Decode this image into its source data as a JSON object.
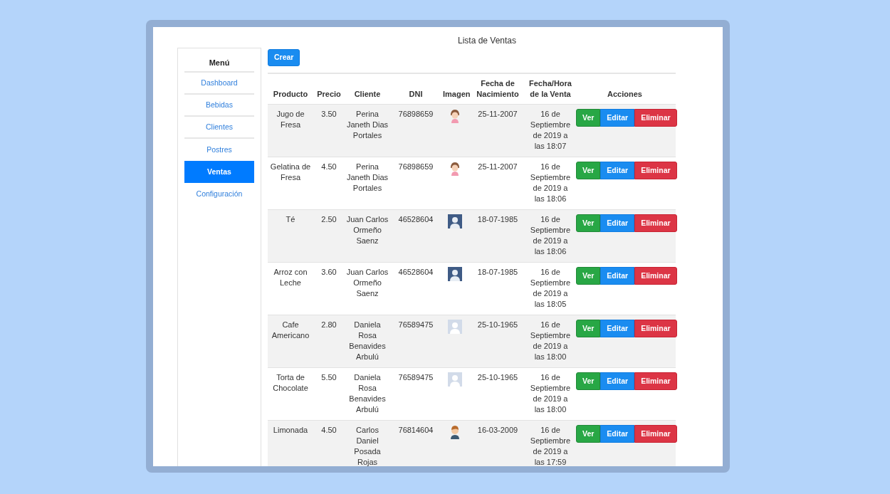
{
  "page_title": "Lista de Ventas",
  "sidebar": {
    "heading": "Menú",
    "items": [
      {
        "label": "Dashboard",
        "selected": false
      },
      {
        "label": "Bebidas",
        "selected": false
      },
      {
        "label": "Clientes",
        "selected": false
      },
      {
        "label": "Postres",
        "selected": false
      },
      {
        "label": "Ventas",
        "selected": true
      },
      {
        "label": "Configuración",
        "selected": false
      }
    ]
  },
  "create_button": "Crear",
  "table": {
    "columns": [
      "Producto",
      "Precio",
      "Cliente",
      "DNI",
      "Imagen",
      "Fecha de Nacimiento",
      "Fecha/Hora de la Venta",
      "Acciones"
    ],
    "rows": [
      {
        "product": "Jugo de Fresa",
        "price": "3.50",
        "client": "Perina Janeth Dias Portales",
        "dni": "76898659",
        "avatar": {
          "kind": "girl"
        },
        "birth": "25-11-2007",
        "sale": "16 de Septiembre de 2019 a las 18:07",
        "actions": [
          "Ver",
          "Editar",
          "Eliminar"
        ]
      },
      {
        "product": "Gelatina de Fresa",
        "price": "4.50",
        "client": "Perina Janeth Dias Portales",
        "dni": "76898659",
        "avatar": {
          "kind": "girl"
        },
        "birth": "25-11-2007",
        "sale": "16 de Septiembre de 2019 a las 18:06",
        "actions": [
          "Ver",
          "Editar",
          "Eliminar"
        ]
      },
      {
        "product": "Té",
        "price": "2.50",
        "client": "Juan Carlos Ormeño Saenz",
        "dni": "46528604",
        "avatar": {
          "kind": "dark-silhouette"
        },
        "birth": "18-07-1985",
        "sale": "16 de Septiembre de 2019 a las 18:06",
        "actions": [
          "Ver",
          "Editar",
          "Eliminar"
        ]
      },
      {
        "product": "Arroz con Leche",
        "price": "3.60",
        "client": "Juan Carlos Ormeño Saenz",
        "dni": "46528604",
        "avatar": {
          "kind": "dark-silhouette"
        },
        "birth": "18-07-1985",
        "sale": "16 de Septiembre de 2019 a las 18:05",
        "actions": [
          "Ver",
          "Editar",
          "Eliminar"
        ]
      },
      {
        "product": "Cafe Americano",
        "price": "2.80",
        "client": "Daniela Rosa Benavides Arbulú",
        "dni": "76589475",
        "avatar": {
          "kind": "light-silhouette"
        },
        "birth": "25-10-1965",
        "sale": "16 de Septiembre de 2019 a las 18:00",
        "actions": [
          "Ver",
          "Editar",
          "Eliminar"
        ]
      },
      {
        "product": "Torta de Chocolate",
        "price": "5.50",
        "client": "Daniela Rosa Benavides Arbulú",
        "dni": "76589475",
        "avatar": {
          "kind": "light-silhouette"
        },
        "birth": "25-10-1965",
        "sale": "16 de Septiembre de 2019 a las 18:00",
        "actions": [
          "Ver",
          "Editar",
          "Eliminar"
        ]
      },
      {
        "product": "Limonada",
        "price": "4.50",
        "client": "Carlos Daniel Posada Rojas",
        "dni": "76814604",
        "avatar": {
          "kind": "boy"
        },
        "birth": "16-03-2009",
        "sale": "16 de Septiembre de 2019 a las 17:59",
        "actions": [
          "Ver",
          "Editar",
          "Eliminar"
        ]
      }
    ]
  }
}
